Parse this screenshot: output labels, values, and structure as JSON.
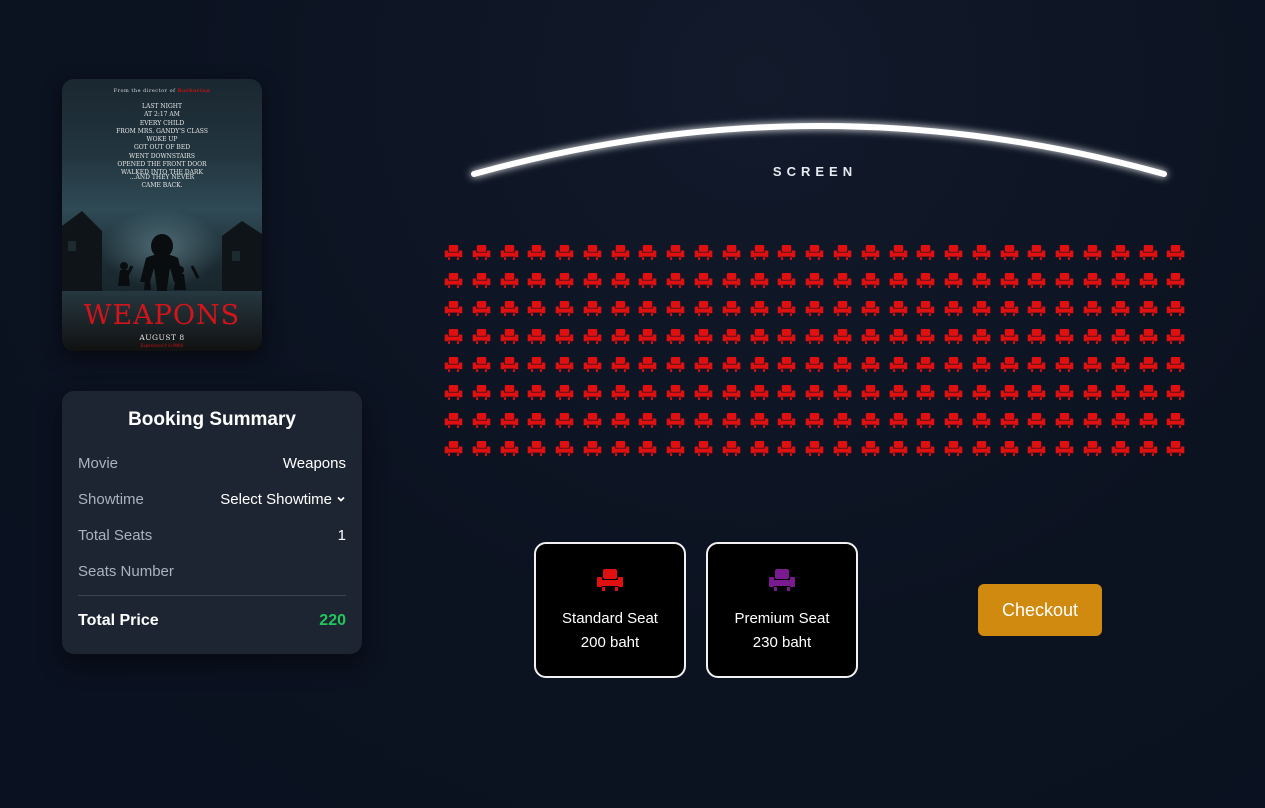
{
  "poster": {
    "director_prefix": "From the director of",
    "director_film": "Barbarian",
    "tagline_lines": [
      "Last night",
      "at 2:17 am",
      "every child",
      "from Mrs. Gandy's class",
      "woke up",
      "got out of bed",
      "went downstairs",
      "opened the front door",
      "walked into the dark"
    ],
    "tagline_end": [
      "...and they never",
      "came back."
    ],
    "title": "WEAPONS",
    "release_date": "AUGUST 8",
    "release_prefix": "Only in theatres",
    "release_sub": "Experience it in IMAX"
  },
  "summary": {
    "heading": "Booking Summary",
    "movie_label": "Movie",
    "movie_value": "Weapons",
    "showtime_label": "Showtime",
    "showtime_value": "Select Showtime",
    "total_seats_label": "Total Seats",
    "total_seats_value": "1",
    "seats_number_label": "Seats Number",
    "seats_number_value": "",
    "total_price_label": "Total Price",
    "total_price_value": "220"
  },
  "screen": {
    "label": "SCREEN"
  },
  "seatmap": {
    "rows": 8,
    "cols": 27,
    "seat_color": "#e01010",
    "seat_icon": "seat-icon"
  },
  "legend": [
    {
      "name": "Standard Seat",
      "price": "200 baht",
      "color": "#e01010"
    },
    {
      "name": "Premium Seat",
      "price": "230 baht",
      "color": "#7a1a8f"
    }
  ],
  "checkout": {
    "label": "Checkout",
    "color": "#cf8a0f"
  }
}
